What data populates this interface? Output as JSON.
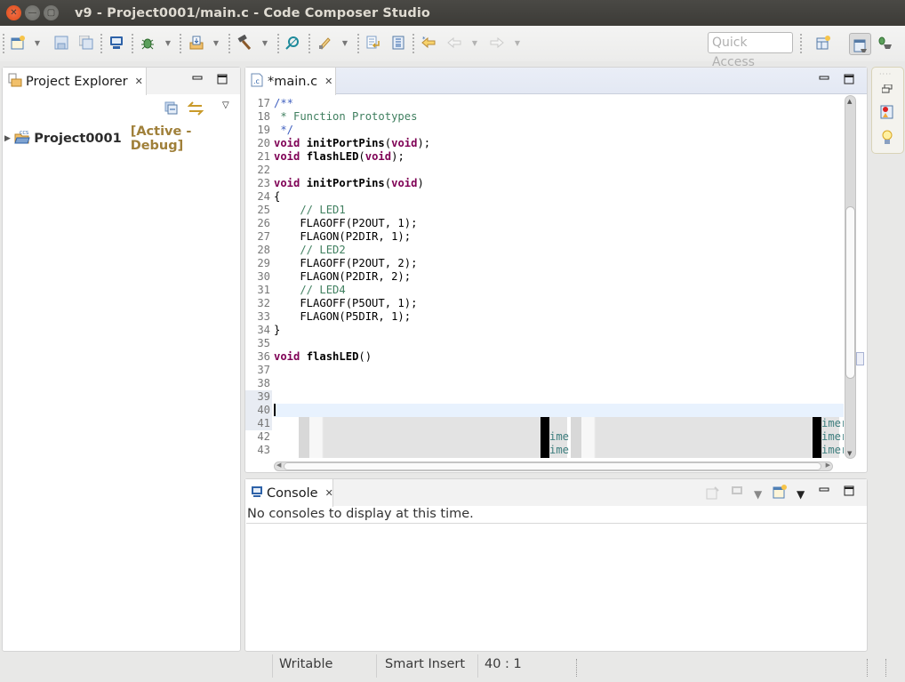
{
  "window": {
    "title": "v9 - Project0001/main.c - Code Composer Studio",
    "buttons": [
      "close",
      "minimize",
      "maximize"
    ]
  },
  "toolbar": {
    "quick_access_placeholder": "Quick Access",
    "icons": [
      "new-icon",
      "save-icon",
      "save-all-icon",
      "terminal-icon",
      "debug-icon",
      "import-icon",
      "build-icon",
      "search-icon",
      "flash-icon",
      "next-annotation-icon",
      "toggle-block-icon",
      "last-edit-icon",
      "back-icon",
      "forward-icon",
      "open-perspective-icon",
      "ccs-edit-perspective-icon",
      "ccs-debug-perspective-icon"
    ]
  },
  "project_explorer": {
    "tab_label": "Project Explorer",
    "project_name": "Project0001",
    "project_status": "[Active - Debug]",
    "colors": {
      "status": "#a0803a"
    }
  },
  "editor": {
    "tab_label": "*main.c",
    "current_line": 40,
    "lines": [
      {
        "n": "17",
        "parts": [
          [
            "cmd",
            "/**"
          ]
        ]
      },
      {
        "n": "18",
        "parts": [
          [
            "cm",
            " * Function Prototypes"
          ]
        ]
      },
      {
        "n": "19",
        "parts": [
          [
            "cmd",
            " */"
          ]
        ]
      },
      {
        "n": "20",
        "parts": [
          [
            "kw",
            "void"
          ],
          [
            "",
            "",
            " "
          ],
          [
            "fn",
            "initPortPins"
          ],
          [
            "",
            "("
          ],
          [
            "kw",
            "void"
          ],
          [
            "",
            ");"
          ]
        ]
      },
      {
        "n": "21",
        "parts": [
          [
            "kw",
            "void"
          ],
          [
            "",
            " "
          ],
          [
            "fn",
            "flashLED"
          ],
          [
            "",
            "("
          ],
          [
            "kw",
            "void"
          ],
          [
            "",
            ");"
          ]
        ]
      },
      {
        "n": "22",
        "parts": []
      },
      {
        "n": "23",
        "parts": [
          [
            "kw",
            "void"
          ],
          [
            "",
            " "
          ],
          [
            "fn",
            "initPortPins"
          ],
          [
            "",
            "("
          ],
          [
            "kw",
            "void"
          ],
          [
            "",
            ")"
          ]
        ]
      },
      {
        "n": "24",
        "parts": [
          [
            "",
            "{"
          ]
        ]
      },
      {
        "n": "25",
        "parts": [
          [
            "cm",
            "    // LED1"
          ]
        ]
      },
      {
        "n": "26",
        "parts": [
          [
            "",
            "    FLAGOFF(P2OUT, 1);"
          ]
        ]
      },
      {
        "n": "27",
        "parts": [
          [
            "",
            "    FLAGON(P2DIR, 1);"
          ]
        ]
      },
      {
        "n": "28",
        "parts": [
          [
            "cm",
            "    // LED2"
          ]
        ]
      },
      {
        "n": "29",
        "parts": [
          [
            "",
            "    FLAGOFF(P2OUT, 2);"
          ]
        ]
      },
      {
        "n": "30",
        "parts": [
          [
            "",
            "    FLAGON(P2DIR, 2);"
          ]
        ]
      },
      {
        "n": "31",
        "parts": [
          [
            "cm",
            "    // LED4"
          ]
        ]
      },
      {
        "n": "32",
        "parts": [
          [
            "",
            "    FLAGOFF(P5OUT, 1);"
          ]
        ]
      },
      {
        "n": "33",
        "parts": [
          [
            "",
            "    FLAGON(P5DIR, 1);"
          ]
        ]
      },
      {
        "n": "34",
        "parts": [
          [
            "",
            "}"
          ]
        ]
      },
      {
        "n": "35",
        "parts": []
      },
      {
        "n": "36",
        "parts": [
          [
            "kw",
            "void"
          ],
          [
            "",
            " "
          ],
          [
            "fn",
            "flashLED"
          ],
          [
            "",
            "()"
          ]
        ]
      },
      {
        "n": "37",
        "parts": []
      },
      {
        "n": "38",
        "parts": []
      },
      {
        "n": "39",
        "parts": []
      },
      {
        "n": "40",
        "parts": []
      },
      {
        "n": "41",
        "parts": []
      },
      {
        "n": "42",
        "parts": []
      },
      {
        "n": "43",
        "parts": []
      }
    ],
    "artifact_text": "imer"
  },
  "console": {
    "tab_label": "Console",
    "message": "No consoles to display at this time."
  },
  "statusbar": {
    "writable": "Writable",
    "insert_mode": "Smart Insert",
    "position": "40 : 1"
  }
}
